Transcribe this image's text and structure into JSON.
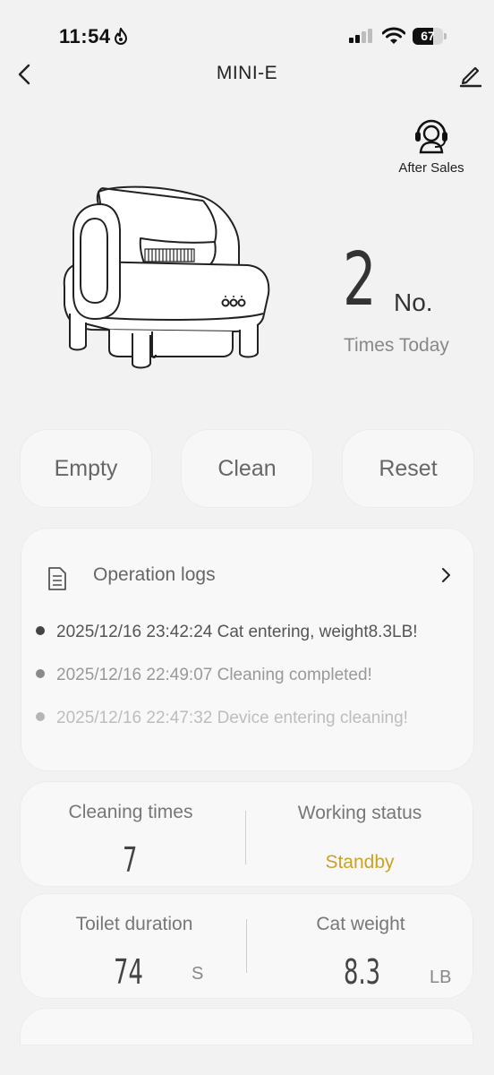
{
  "status_bar": {
    "time": "11:54",
    "battery": "67",
    "battery_level_percent": 67
  },
  "nav": {
    "title": "MINI-E"
  },
  "after_sales": {
    "label": "After Sales"
  },
  "device": {
    "icon": "litter-box-device-illustration"
  },
  "today": {
    "count": "2",
    "unit": "No.",
    "label": "Times Today"
  },
  "actions": [
    "Empty",
    "Clean",
    "Reset"
  ],
  "logs": {
    "title": "Operation logs",
    "entries": [
      {
        "text": "2025/12/16 23:42:24 Cat entering, weight8.3LB!",
        "color": "#555555",
        "dot": "#444444"
      },
      {
        "text": "2025/12/16 22:49:07 Cleaning completed!",
        "color": "#999999",
        "dot": "#8a8a8a"
      },
      {
        "text": "2025/12/16 22:47:32 Device entering cleaning!",
        "color": "#bdbdbd",
        "dot": "#b5b5b5"
      }
    ]
  },
  "stats": {
    "cleaning_times": {
      "label": "Cleaning times",
      "value": "7"
    },
    "working_status": {
      "label": "Working status",
      "value": "Standby",
      "color": "#c9a227"
    },
    "toilet_duration": {
      "label": "Toilet duration",
      "value": "74",
      "unit": "S"
    },
    "cat_weight": {
      "label": "Cat weight",
      "value": "8.3",
      "unit": "LB"
    }
  }
}
